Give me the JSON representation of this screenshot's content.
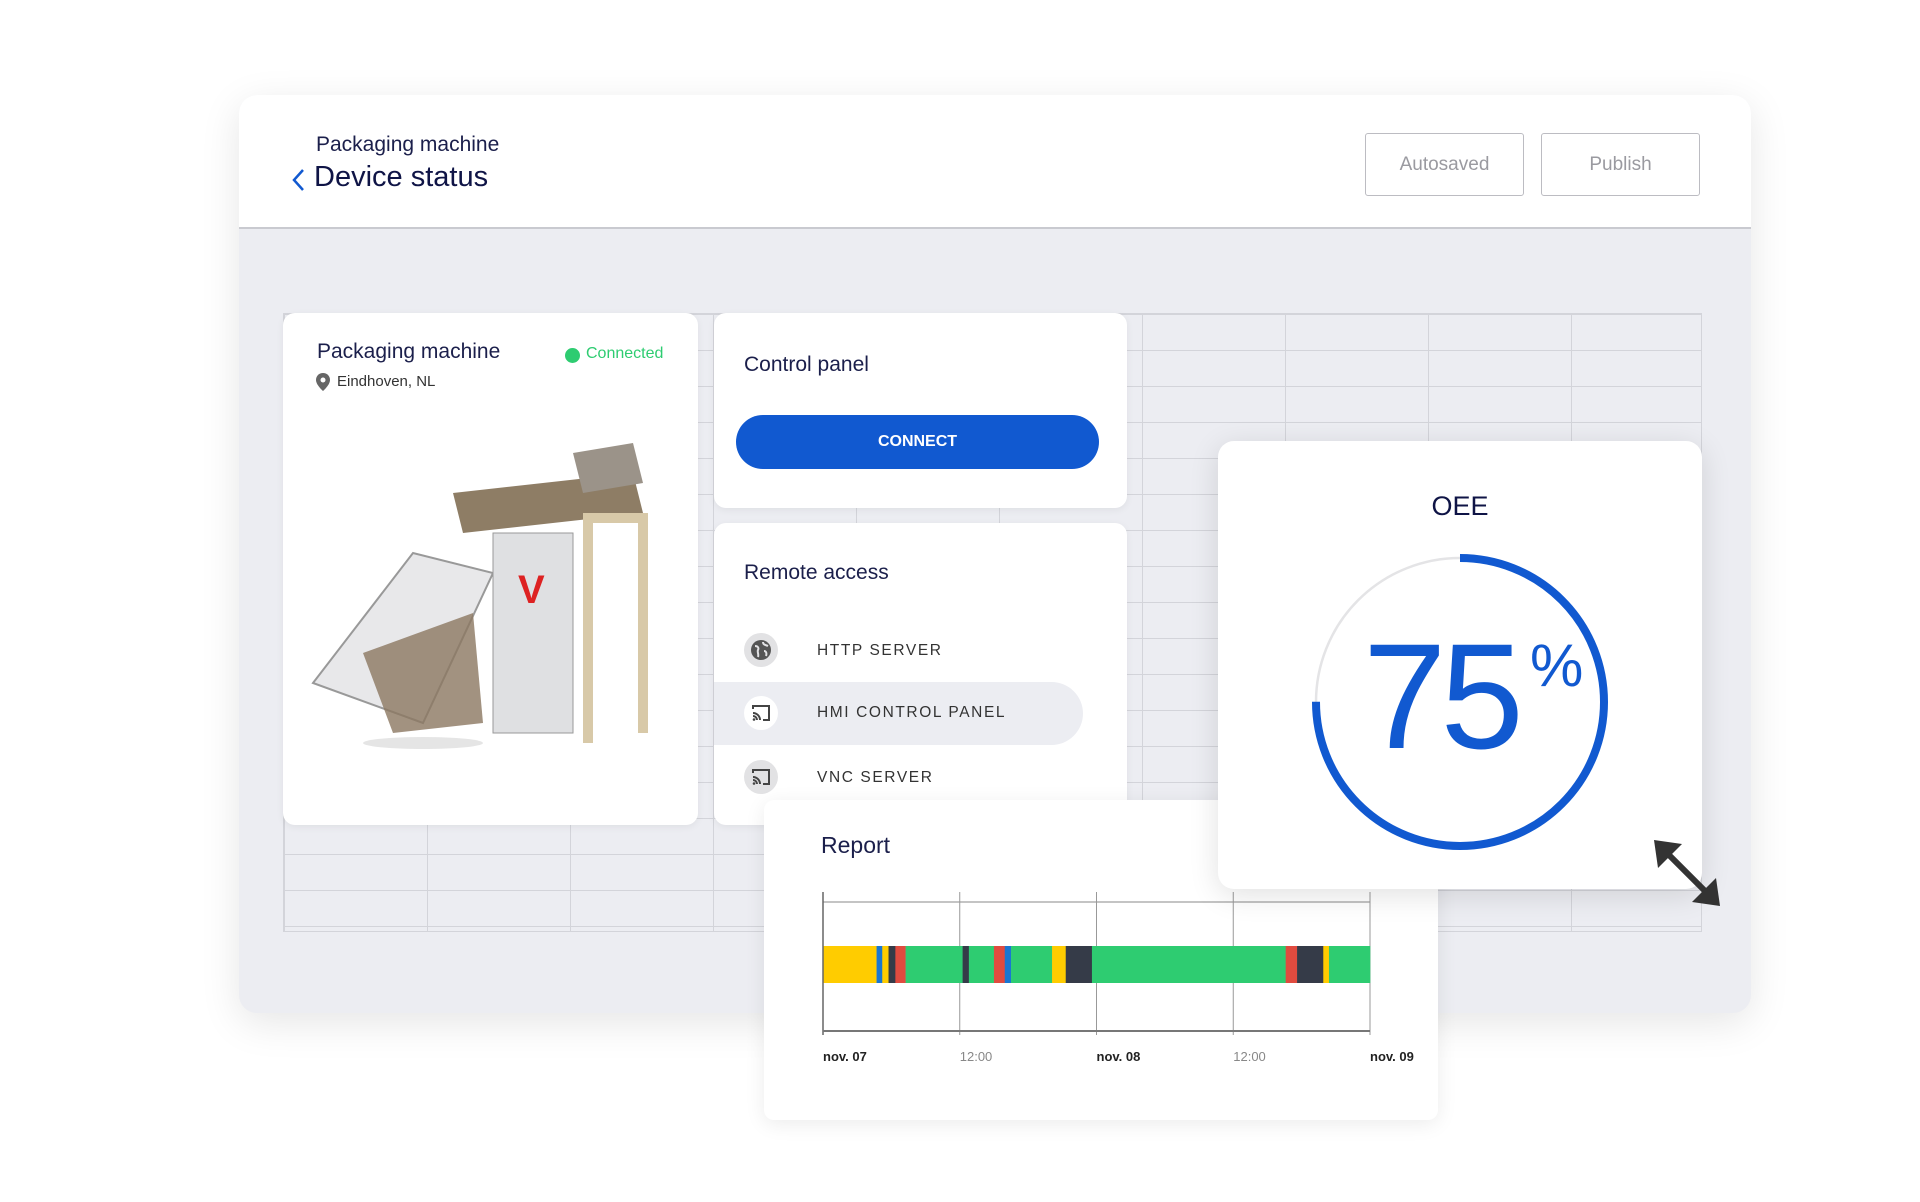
{
  "header": {
    "breadcrumb": "Packaging machine",
    "title": "Device status",
    "autosaved_label": "Autosaved",
    "publish_label": "Publish"
  },
  "device_card": {
    "name": "Packaging machine",
    "status": "Connected",
    "status_color": "#2ecc71",
    "location": "Eindhoven, NL",
    "location_icon": "map-pin-icon"
  },
  "control_panel": {
    "title": "Control panel",
    "connect_label": "CONNECT",
    "accent": "#1159d0"
  },
  "remote_access": {
    "title": "Remote access",
    "items": [
      {
        "label": "HTTP SERVER",
        "icon": "globe-icon",
        "selected": false
      },
      {
        "label": "HMI CONTROL PANEL",
        "icon": "cast-icon",
        "selected": true
      },
      {
        "label": "VNC SERVER",
        "icon": "cast-icon",
        "selected": false
      }
    ]
  },
  "oee": {
    "title": "OEE",
    "value": "75",
    "unit": "%",
    "fraction": 0.75,
    "color": "#1159d0"
  },
  "report": {
    "title": "Report"
  },
  "chart_data": {
    "type": "timeline",
    "x_range_hours": [
      0,
      48
    ],
    "x_ticks": [
      {
        "hour": 0,
        "label": "nov. 07",
        "bold": true
      },
      {
        "hour": 12,
        "label": "12:00",
        "bold": false
      },
      {
        "hour": 24,
        "label": "nov. 08",
        "bold": true
      },
      {
        "hour": 36,
        "label": "12:00",
        "bold": false
      },
      {
        "hour": 48,
        "label": "nov. 09",
        "bold": true
      }
    ],
    "state_colors": {
      "yellow": "#ffcc00",
      "blue": "#1976d2",
      "dark": "#353b48",
      "red": "#e04b3f",
      "green": "#2ecc71"
    },
    "segments": [
      {
        "start": 0,
        "end": 4.7,
        "state": "yellow"
      },
      {
        "start": 4.7,
        "end": 5.2,
        "state": "blue"
      },
      {
        "start": 5.2,
        "end": 5.75,
        "state": "yellow"
      },
      {
        "start": 5.75,
        "end": 6.35,
        "state": "dark"
      },
      {
        "start": 6.35,
        "end": 7.25,
        "state": "red"
      },
      {
        "start": 7.25,
        "end": 12.25,
        "state": "green"
      },
      {
        "start": 12.25,
        "end": 12.8,
        "state": "dark"
      },
      {
        "start": 12.8,
        "end": 15.0,
        "state": "green"
      },
      {
        "start": 15.0,
        "end": 15.95,
        "state": "red"
      },
      {
        "start": 15.95,
        "end": 16.5,
        "state": "blue"
      },
      {
        "start": 16.5,
        "end": 20.1,
        "state": "green"
      },
      {
        "start": 20.1,
        "end": 21.3,
        "state": "yellow"
      },
      {
        "start": 21.3,
        "end": 23.6,
        "state": "dark"
      },
      {
        "start": 23.6,
        "end": 40.6,
        "state": "green"
      },
      {
        "start": 40.6,
        "end": 41.6,
        "state": "red"
      },
      {
        "start": 41.6,
        "end": 43.9,
        "state": "dark"
      },
      {
        "start": 43.9,
        "end": 44.4,
        "state": "yellow"
      },
      {
        "start": 44.4,
        "end": 48,
        "state": "green"
      }
    ]
  }
}
